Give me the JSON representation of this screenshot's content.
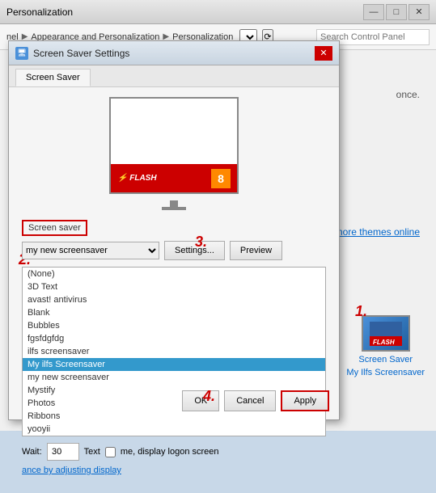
{
  "bgWindow": {
    "title": "Personalization",
    "controls": {
      "minimize": "—",
      "maximize": "□",
      "close": "✕"
    },
    "addressBar": {
      "parts": [
        "nel",
        "Appearance and Personalization",
        "Personalization"
      ],
      "searchPlaceholder": "Search Control Panel"
    }
  },
  "rightPanel": {
    "onceLabelText": "once.",
    "moreThemesText": "more themes online",
    "screenSaverThumb": {
      "label1": "Screen Saver",
      "label2": "My Ilfs Screensaver"
    }
  },
  "modal": {
    "title": "Screen Saver Settings",
    "closeBtn": "✕",
    "tab": "Screen Saver",
    "screenSaverSectionLabel": "Screen saver",
    "dropdownValue": "my new screensaver",
    "dropdownItems": [
      "(None)",
      "3D Text",
      "avast! antivirus",
      "Blank",
      "Bubbles",
      "fgsfdgfdg",
      "ilfs screensaver",
      "My ilfs Screensaver",
      "my new screensaver",
      "Mystify",
      "Photos",
      "Ribbons",
      "yooyii"
    ],
    "settingsBtn": "Settings...",
    "previewBtn": "Preview",
    "waitLabel": "Wait:",
    "waitValue": "30",
    "waitUnit": "Text",
    "logonText": "me, display logon screen",
    "powerText": "ance by adjusting display",
    "footerOk": "OK",
    "footerCancel": "Cancel",
    "footerApply": "Apply"
  },
  "annotations": {
    "one": "1.",
    "two": "2.",
    "three": "3.",
    "four": "4."
  }
}
